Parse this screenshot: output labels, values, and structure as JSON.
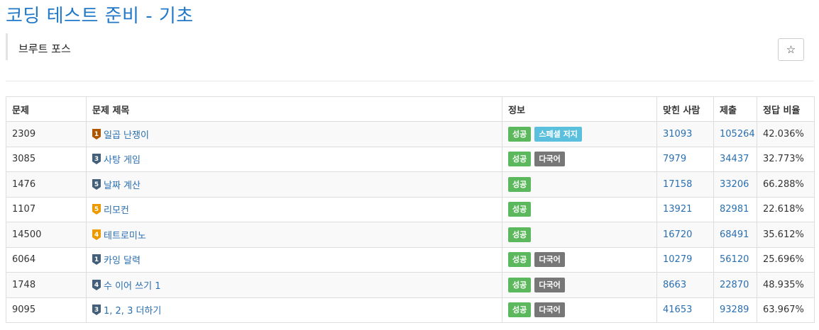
{
  "page": {
    "title": "코딩 테스트 준비 - 기초"
  },
  "section": {
    "title": "브루트 포스",
    "star_symbol": "☆"
  },
  "table": {
    "headers": {
      "id": "문제",
      "title": "문제 제목",
      "info": "정보",
      "solvers": "맞힌 사람",
      "submissions": "제출",
      "ratio": "정답 비율"
    },
    "rows": [
      {
        "id": "2309",
        "tier_color": "#ad5600",
        "tier_num": "1",
        "title": "일곱 난쟁이",
        "labels": [
          {
            "text": "성공",
            "kind": "success"
          },
          {
            "text": "스페셜 저지",
            "kind": "info"
          }
        ],
        "solvers": "31093",
        "submissions": "105264",
        "ratio": "42.036%"
      },
      {
        "id": "3085",
        "tier_color": "#435f7a",
        "tier_num": "3",
        "title": "사탕 게임",
        "labels": [
          {
            "text": "성공",
            "kind": "success"
          },
          {
            "text": "다국어",
            "kind": "default"
          }
        ],
        "solvers": "7979",
        "submissions": "34437",
        "ratio": "32.773%"
      },
      {
        "id": "1476",
        "tier_color": "#435f7a",
        "tier_num": "5",
        "title": "날짜 계산",
        "labels": [
          {
            "text": "성공",
            "kind": "success"
          }
        ],
        "solvers": "17158",
        "submissions": "33206",
        "ratio": "66.288%"
      },
      {
        "id": "1107",
        "tier_color": "#ec9a00",
        "tier_num": "5",
        "title": "리모컨",
        "labels": [
          {
            "text": "성공",
            "kind": "success"
          }
        ],
        "solvers": "13921",
        "submissions": "82981",
        "ratio": "22.618%"
      },
      {
        "id": "14500",
        "tier_color": "#ec9a00",
        "tier_num": "4",
        "title": "테트로미노",
        "labels": [
          {
            "text": "성공",
            "kind": "success"
          }
        ],
        "solvers": "16720",
        "submissions": "68491",
        "ratio": "35.612%"
      },
      {
        "id": "6064",
        "tier_color": "#435f7a",
        "tier_num": "1",
        "title": "카잉 달력",
        "labels": [
          {
            "text": "성공",
            "kind": "success"
          },
          {
            "text": "다국어",
            "kind": "default"
          }
        ],
        "solvers": "10279",
        "submissions": "56120",
        "ratio": "25.696%"
      },
      {
        "id": "1748",
        "tier_color": "#435f7a",
        "tier_num": "4",
        "title": "수 이어 쓰기 1",
        "labels": [
          {
            "text": "성공",
            "kind": "success"
          },
          {
            "text": "다국어",
            "kind": "default"
          }
        ],
        "solvers": "8663",
        "submissions": "22870",
        "ratio": "48.935%"
      },
      {
        "id": "9095",
        "tier_color": "#435f7a",
        "tier_num": "3",
        "title": "1, 2, 3 더하기",
        "labels": [
          {
            "text": "성공",
            "kind": "success"
          },
          {
            "text": "다국어",
            "kind": "default"
          }
        ],
        "solvers": "41653",
        "submissions": "93289",
        "ratio": "63.967%"
      }
    ]
  }
}
